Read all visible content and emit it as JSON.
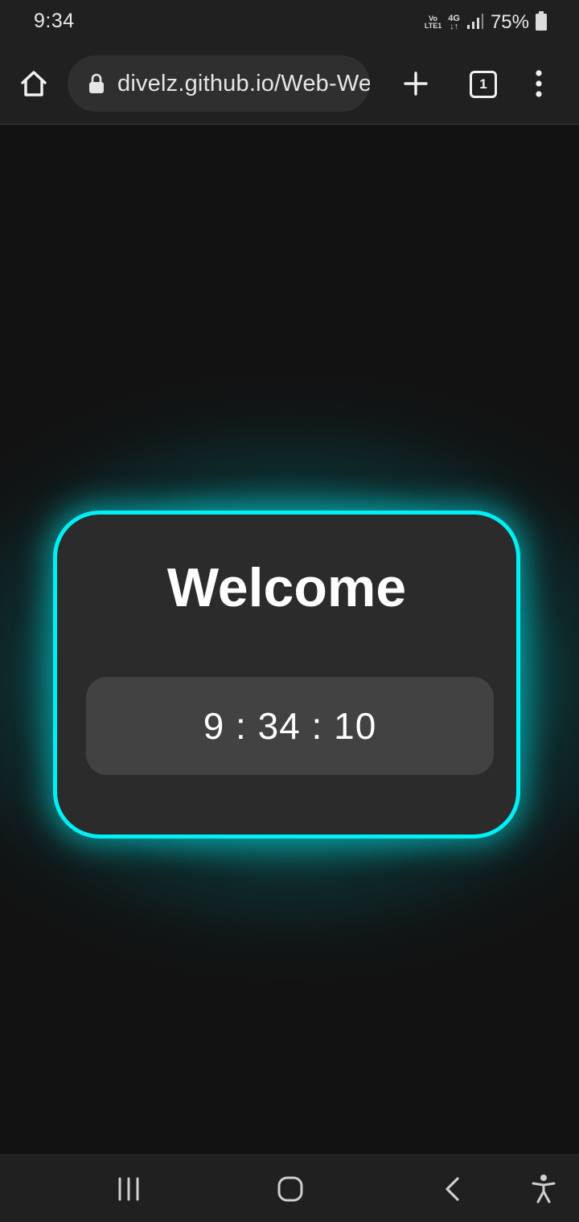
{
  "status_bar": {
    "time": "9:34",
    "volte_top": "Vo",
    "volte_bottom": "LTE1",
    "network_type": "4G",
    "network_arrows": "↓↑",
    "battery_percent": "75%",
    "icons": [
      "signal-icon",
      "battery-icon"
    ]
  },
  "browser": {
    "url": "divelz.github.io/Web-Welcome",
    "tab_count": "1",
    "icons": [
      "home-icon",
      "lock-icon",
      "plus-icon",
      "tabs-icon",
      "more-vert-icon"
    ]
  },
  "page": {
    "title": "Welcome",
    "clock": "9 : 34 : 10",
    "accent_color": "#00f0f5",
    "card_color": "#2b2b2b",
    "clock_box_color": "#424242",
    "background_color": "#121212"
  },
  "nav_bar": {
    "icons": [
      "recents-icon",
      "home-circle-icon",
      "back-icon",
      "accessibility-icon"
    ]
  }
}
